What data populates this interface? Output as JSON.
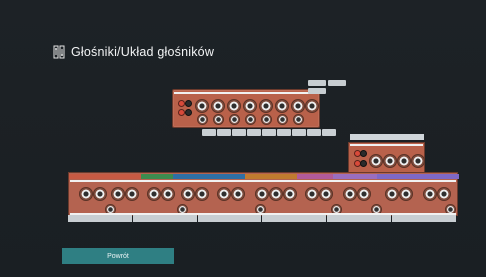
{
  "header": {
    "icon": "speaker-settings-icon",
    "title": "Głośniki/Układ głośników"
  },
  "top_panel": {
    "chips": [
      "",
      "",
      ""
    ],
    "labels": [
      "",
      "",
      "",
      "",
      "",
      "",
      "",
      "",
      ""
    ]
  },
  "top_module": {
    "label": ""
  },
  "bottom_panel": {
    "sections": [
      "",
      "",
      "",
      "",
      "",
      "",
      "",
      "",
      "",
      ""
    ],
    "channels": [
      "",
      "",
      "",
      "",
      "",
      ""
    ]
  },
  "back_button": {
    "label": "Powrót"
  },
  "colors": {
    "background": "#1b2024",
    "panel": "#b46350",
    "accent": "#2f7f83"
  }
}
